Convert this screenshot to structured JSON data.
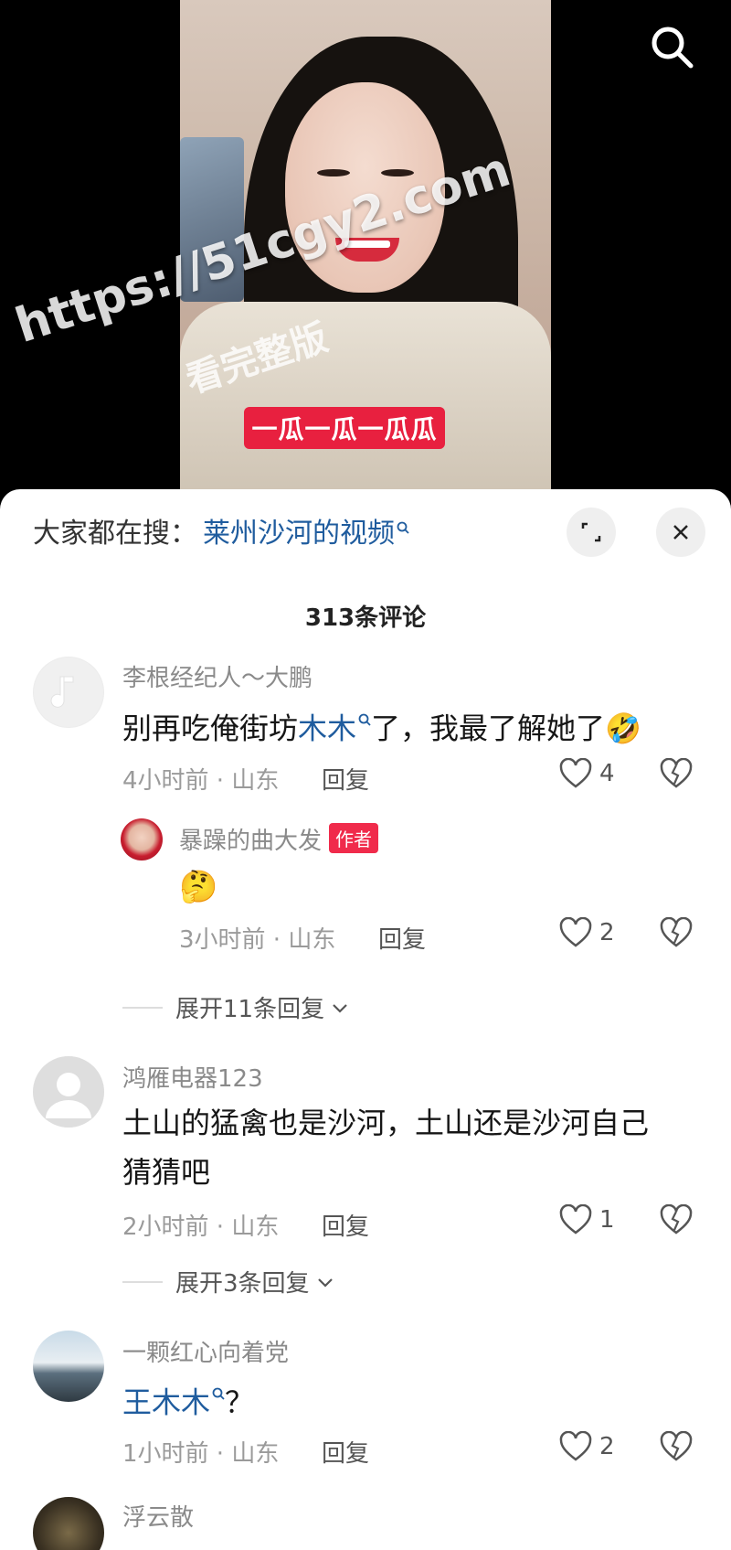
{
  "video": {
    "caption": "一瓜一瓜一瓜瓜",
    "watermark_url": "https://51cgy2.com",
    "watermark_sub": "看完整版"
  },
  "sheet": {
    "search_prefix": "大家都在搜：",
    "search_term": "莱州沙河的视频",
    "comment_count": "313条评论"
  },
  "comments": [
    {
      "username": "李根经纪人～大鹏",
      "text_before": "别再吃俺街坊",
      "link": "木木",
      "text_after": "了，我最了解她了🤣",
      "time": "4小时前 · 山东",
      "reply_label": "回复",
      "likes": "4",
      "reply": {
        "username": "暴躁的曲大发",
        "badge": "作者",
        "text": "🤔",
        "time": "3小时前 · 山东",
        "reply_label": "回复",
        "likes": "2"
      },
      "expand": "展开11条回复"
    },
    {
      "username": "鸿雁电器123",
      "text_line1": "土山的猛禽也是沙河，土山还是沙河自己",
      "text_line2": "猜猜吧",
      "time": "2小时前 · 山东",
      "reply_label": "回复",
      "likes": "1",
      "expand": "展开3条回复"
    },
    {
      "username": "一颗红心向着党",
      "link": "王木木",
      "text_after": "？",
      "time": "1小时前 · 山东",
      "reply_label": "回复",
      "likes": "2"
    },
    {
      "username": "浮云散"
    }
  ],
  "colors": {
    "link": "#1f5c9e",
    "badge": "#f02b4b",
    "caption_bg": "#e8203f"
  }
}
